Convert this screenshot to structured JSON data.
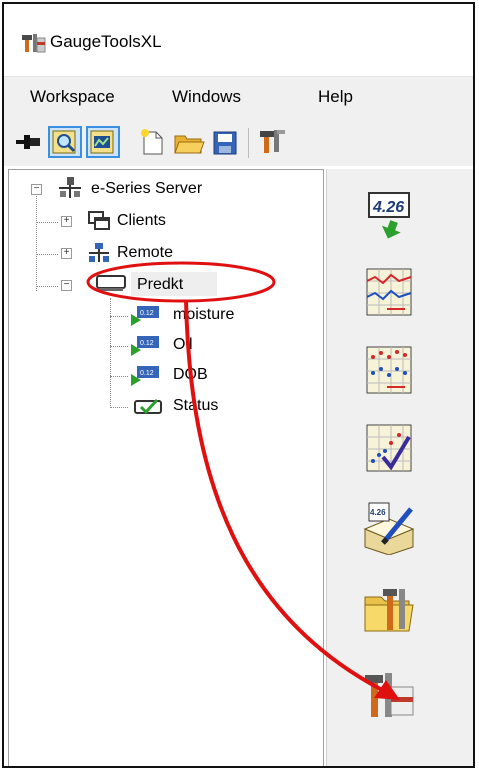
{
  "window": {
    "title": "GaugeToolsXL"
  },
  "menu": {
    "workspace": "Workspace",
    "windows": "Windows",
    "help": "Help"
  },
  "tree": {
    "root": "e-Series Server",
    "clients": "Clients",
    "remote": "Remote",
    "device": "Predkt",
    "children": [
      "moisture",
      "Oil",
      "DOB",
      "Status"
    ]
  },
  "icons": {
    "badge_text": "4.26",
    "mini_badge": "0.12"
  },
  "colors": {
    "annotation": "#e01010",
    "selection": "#3a8fe0",
    "panel": "#f0f0f0"
  }
}
